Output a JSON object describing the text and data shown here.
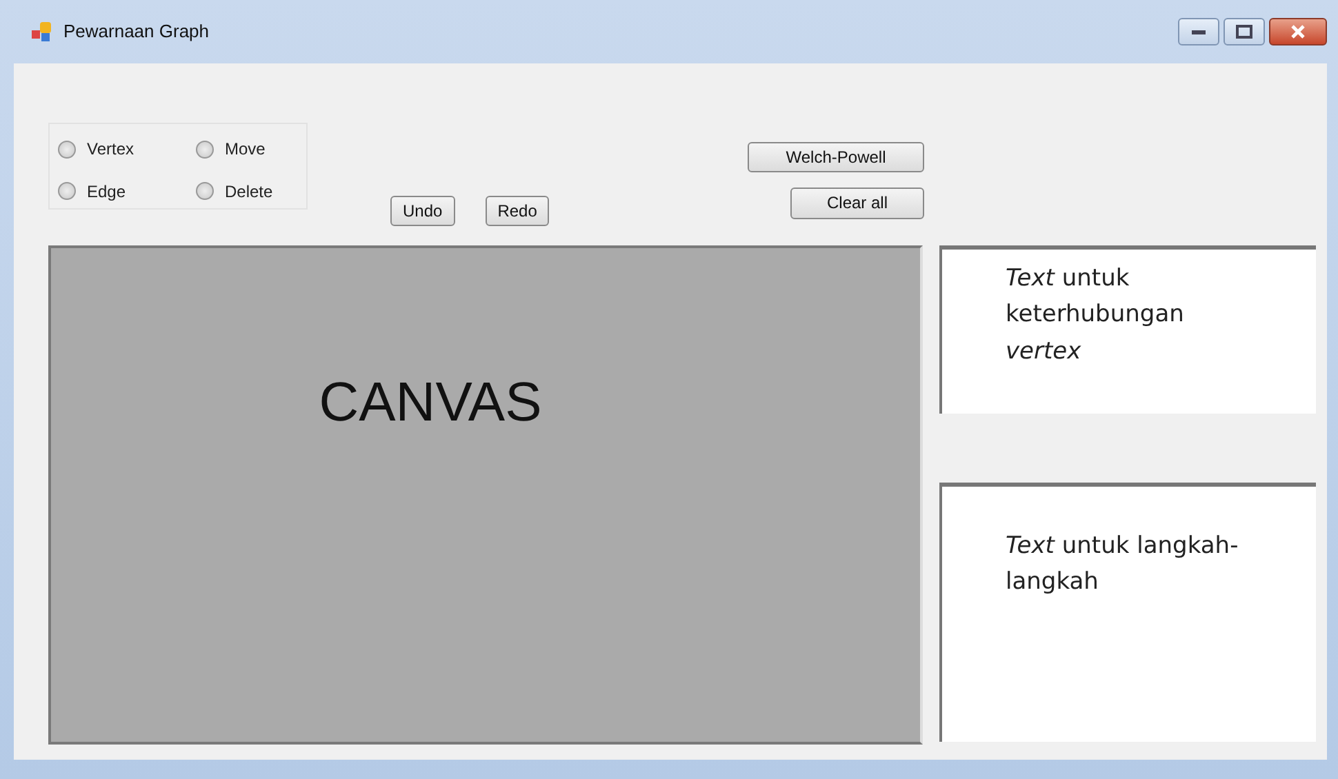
{
  "window": {
    "title": "Pewarnaan Graph"
  },
  "modes": [
    {
      "label": "Vertex",
      "selected": false
    },
    {
      "label": "Move",
      "selected": false
    },
    {
      "label": "Edge",
      "selected": false
    },
    {
      "label": "Delete",
      "selected": false
    }
  ],
  "edit_buttons": [
    "Undo",
    "Redo"
  ],
  "action_buttons": [
    "Welch-Powell",
    "Clear all"
  ],
  "canvas": {
    "label": "CANVAS"
  },
  "text_panels": [
    "*Text* untuk keterhubungan *vertex*",
    "*Text* untuk langkah-langkah"
  ]
}
